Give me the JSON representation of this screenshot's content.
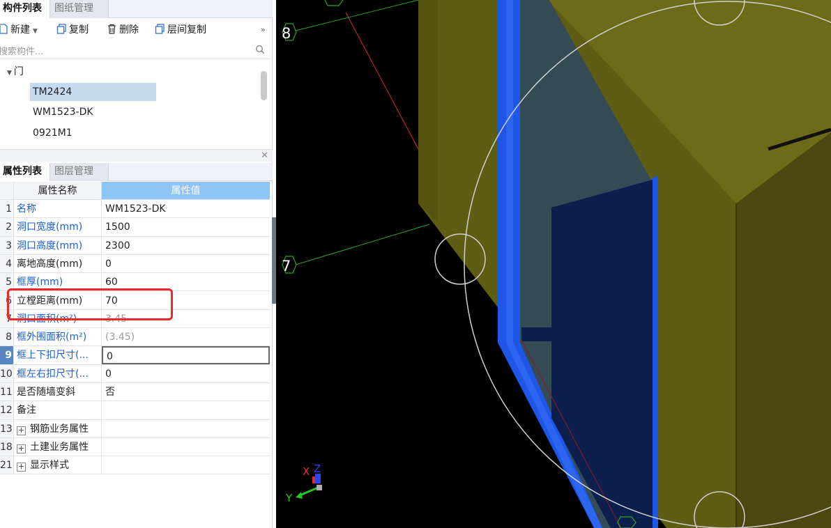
{
  "component_panel": {
    "tabs": [
      {
        "label": "构件列表",
        "active": true
      },
      {
        "label": "图纸管理",
        "active": false
      }
    ],
    "toolbar": {
      "new_label": "新建",
      "copy_label": "复制",
      "delete_label": "删除",
      "floor_copy_label": "层间复制",
      "more_icon": "double-chevron-right-icon"
    },
    "search": {
      "placeholder": "搜索构件..."
    },
    "tree": {
      "group_label": "门",
      "items": [
        {
          "label": "TM2424",
          "selected": true
        },
        {
          "label": "WM1523-DK",
          "selected": false
        },
        {
          "label": "0921M1",
          "selected": false
        }
      ]
    }
  },
  "property_panel": {
    "tabs": [
      {
        "label": "属性列表",
        "active": true
      },
      {
        "label": "图层管理",
        "active": false
      }
    ],
    "headers": {
      "name": "属性名称",
      "value": "属性值"
    },
    "rows": [
      {
        "num": "1",
        "name": "名称",
        "value": "WM1523-DK",
        "name_color": "blue"
      },
      {
        "num": "2",
        "name": "洞口宽度(mm)",
        "value": "1500",
        "name_color": "blue"
      },
      {
        "num": "3",
        "name": "洞口高度(mm)",
        "value": "2300",
        "name_color": "blue"
      },
      {
        "num": "4",
        "name": "离地高度(mm)",
        "value": "0",
        "name_color": "black"
      },
      {
        "num": "5",
        "name": "框厚(mm)",
        "value": "60",
        "name_color": "blue"
      },
      {
        "num": "6",
        "name": "立樘距离(mm)",
        "value": "70",
        "name_color": "black"
      },
      {
        "num": "7",
        "name": "洞口面积(m²)",
        "value": "3.45",
        "name_color": "blue"
      },
      {
        "num": "8",
        "name": "框外围面积(m²)",
        "value": "(3.45)",
        "name_color": "blue"
      },
      {
        "num": "9",
        "name": "框上下扣尺寸(...",
        "value": "0",
        "name_color": "blue"
      },
      {
        "num": "10",
        "name": "框左右扣尺寸(...",
        "value": "0",
        "name_color": "blue"
      },
      {
        "num": "11",
        "name": "是否随墙变斜",
        "value": "否",
        "name_color": "black"
      },
      {
        "num": "12",
        "name": "备注",
        "value": "",
        "name_color": "black"
      },
      {
        "num": "13",
        "name": "钢筋业务属性",
        "value": "",
        "name_color": "black",
        "expandable": true
      },
      {
        "num": "18",
        "name": "土建业务属性",
        "value": "",
        "name_color": "black",
        "expandable": true
      },
      {
        "num": "21",
        "name": "显示样式",
        "value": "",
        "name_color": "black",
        "expandable": true
      }
    ]
  },
  "viewport": {
    "grid_labels": [
      "8",
      "7"
    ],
    "axes": {
      "x": "X",
      "y": "Y",
      "z": "Z"
    },
    "colors": {
      "background": "#000000",
      "wall_front": "#5f5c13",
      "wall_top": "#6e6b18",
      "wall_side": "#4b4910",
      "frame_blue": "#1e56e8",
      "glass": "#344a55",
      "opening": "#0c1f4d"
    }
  },
  "close_icon": "close-icon",
  "highlight_color": "#e8282a"
}
